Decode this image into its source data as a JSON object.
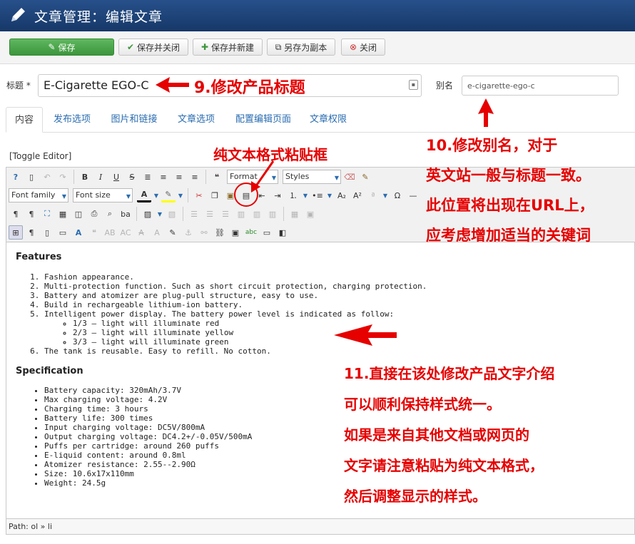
{
  "header": {
    "title": "文章管理：编辑文章"
  },
  "toolbar": {
    "save": "保存",
    "save_close": "保存并关闭",
    "save_new": "保存并新建",
    "save_copy": "另存为副本",
    "close": "关闭"
  },
  "form": {
    "title_label": "标题 *",
    "title_value": "E-Cigarette EGO-C",
    "alias_label": "别名",
    "alias_value": "e-cigarette-ego-c"
  },
  "tabs": [
    "内容",
    "发布选项",
    "图片和链接",
    "文章选项",
    "配置编辑页面",
    "文章权限"
  ],
  "editor": {
    "toggle": "[Toggle Editor]",
    "format_label": "Format",
    "styles_label": "Styles",
    "font_family_label": "Font family",
    "font_size_label": "Font size",
    "path_label": "Path:",
    "path_value": "ol » li"
  },
  "content": {
    "features_heading": "Features",
    "features": [
      "Fashion appearance.",
      "Multi-protection function. Such as short circuit protection, charging protection.",
      "Battery and atomizer are plug-pull structure, easy to use.",
      "Build in rechargeable lithium-ion battery.",
      "Intelligent power display. The battery power level is indicated as follow:",
      "The tank is reusable. Easy to refill. No cotton."
    ],
    "battery_levels": [
      "1/3 – light will illuminate red",
      "2/3 – light will illuminate yellow",
      "3/3 – light will illuminate green"
    ],
    "spec_heading": "Specification",
    "specs": [
      "Battery capacity: 320mAh/3.7V",
      "Max charging voltage: 4.2V",
      "Charging time: 3 hours",
      "Battery life: 300 times",
      "Input charging voltage: DC5V/800mA",
      "Output charging voltage: DC4.2+/-0.05V/500mA",
      "Puffs per cartridge: around 260 puffs",
      "E-liquid content: around 0.8ml",
      "Atomizer resistance: 2.55--2.90Ω",
      "Size: 10.6x17x110mm",
      "Weight: 24.5g"
    ]
  },
  "annotations": {
    "a9": "9.修改产品标题",
    "paste": "纯文本格式粘贴框",
    "a10": [
      "10.修改别名，对于",
      "英文站一般与标题一致。",
      "此位置将出现在URL上，",
      "应考虑增加适当的关键词"
    ],
    "a11": [
      "11.直接在该处修改产品文字介绍",
      "可以顺利保持样式统一。",
      "如果是来自其他文档或网页的",
      "文字请注意粘贴为纯文本格式，",
      "然后调整显示的样式。"
    ],
    "color": "#e60000"
  }
}
